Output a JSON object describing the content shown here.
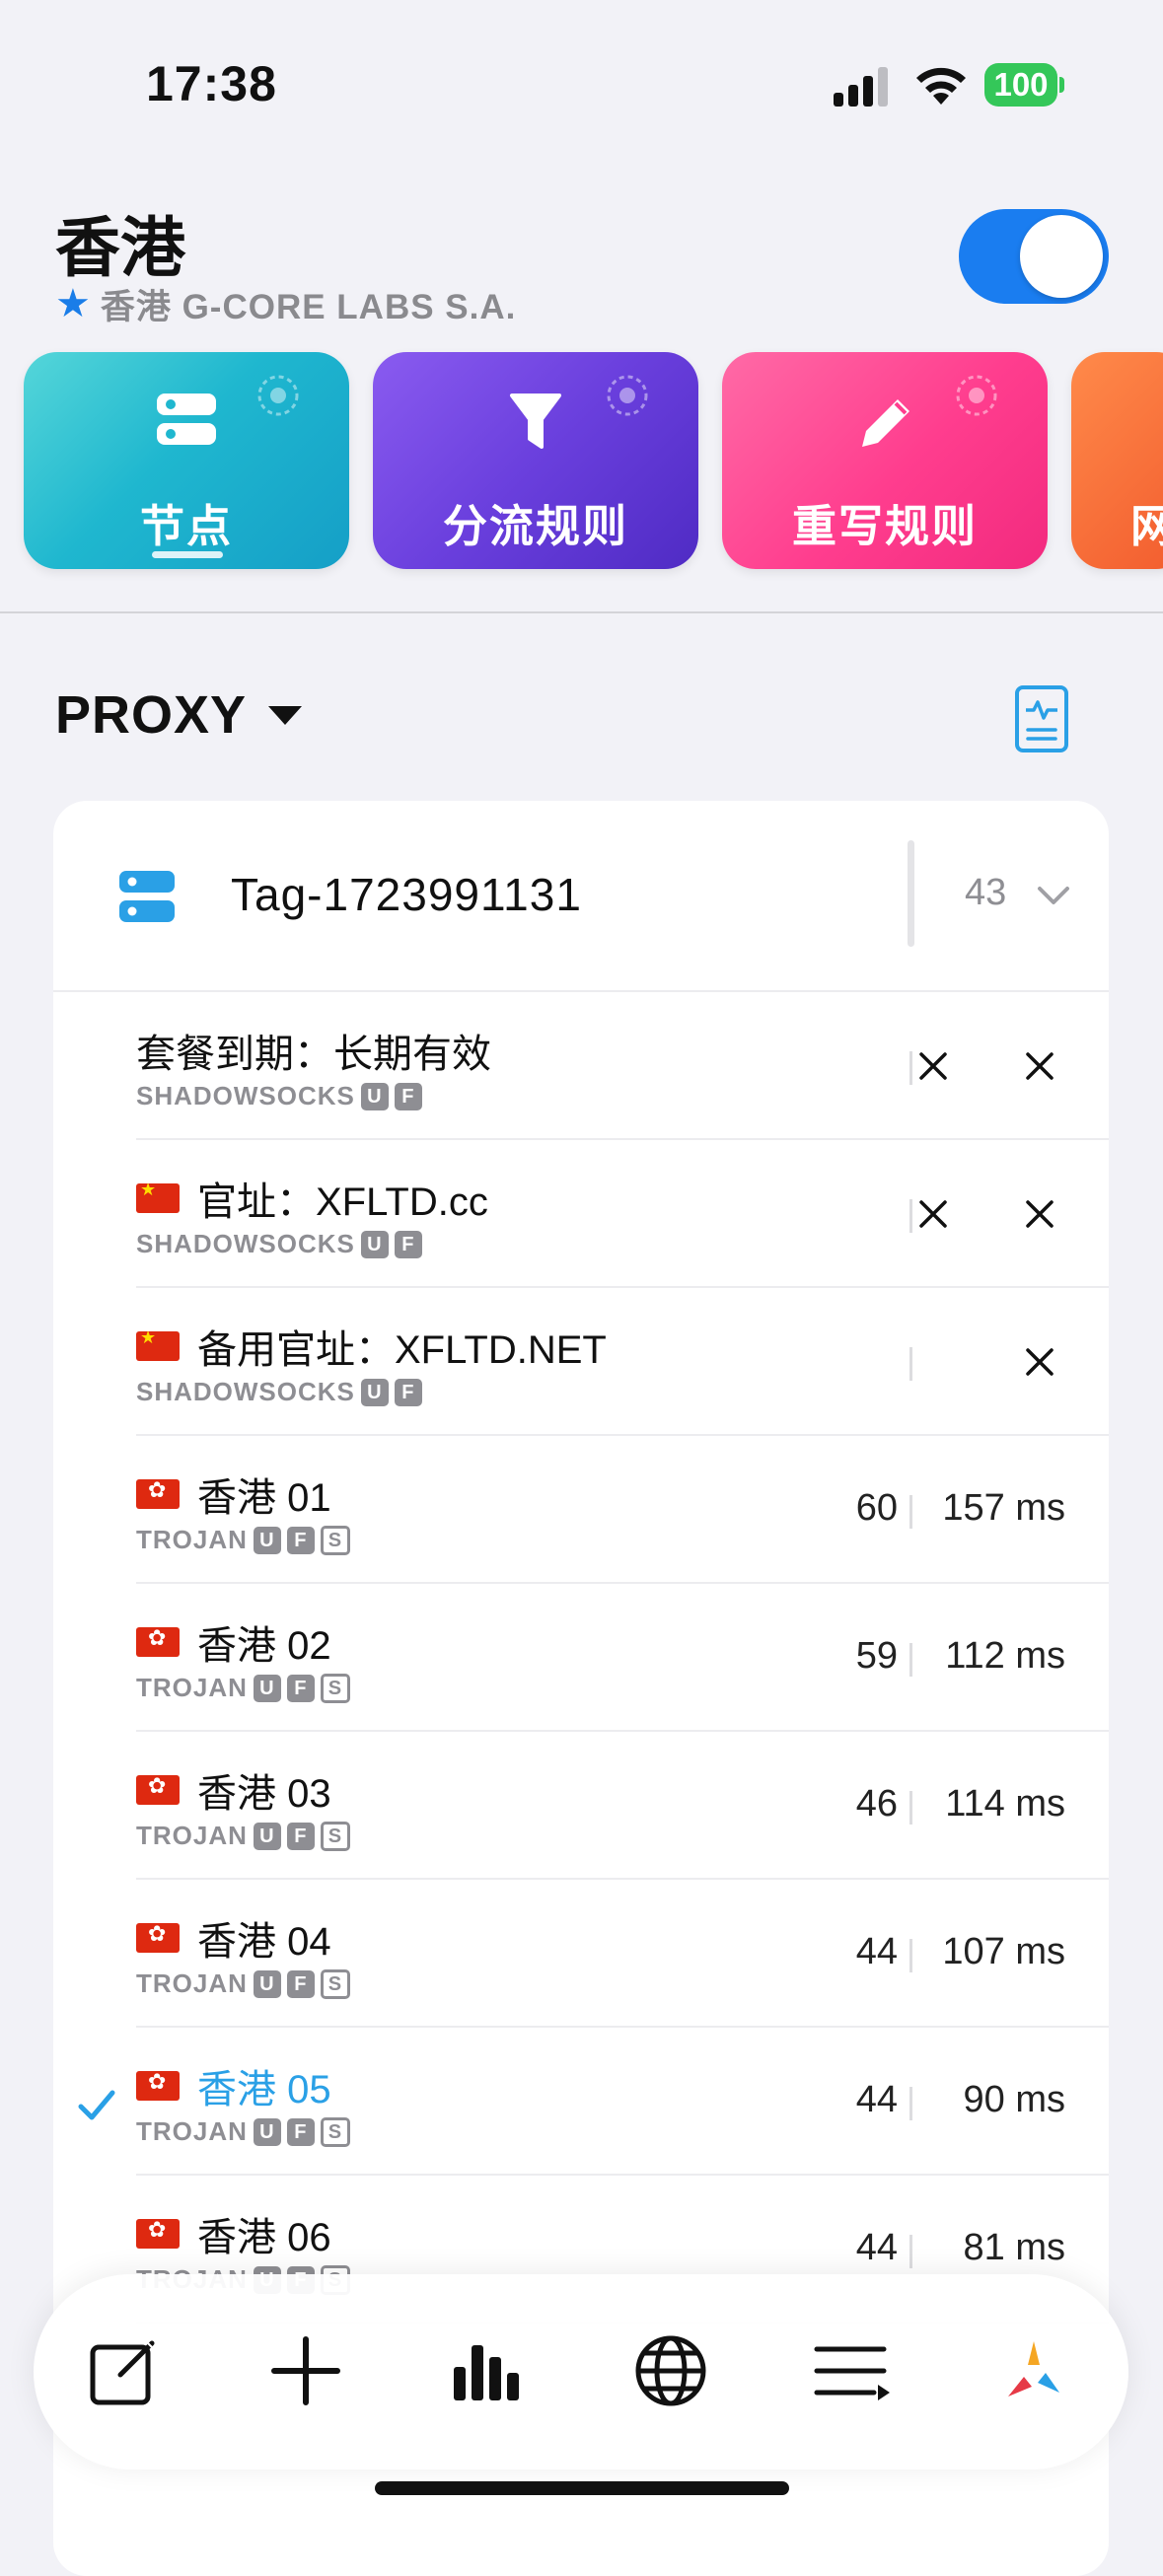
{
  "status": {
    "time": "17:38",
    "battery": "100"
  },
  "header": {
    "title": "香港",
    "subtitle": "香港 G-CORE LABS S.A.",
    "enabled": true
  },
  "cards": [
    {
      "label": "节点",
      "icon": "server-icon",
      "color": "#1fb7cf",
      "active": true
    },
    {
      "label": "分流规则",
      "icon": "filter-icon",
      "color": "#6a3fdd"
    },
    {
      "label": "重写规则",
      "icon": "pencil-icon",
      "color": "#ff3d8e"
    },
    {
      "label": "网",
      "icon": "",
      "color": "#f25c2e"
    }
  ],
  "policy": {
    "name": "PROXY"
  },
  "group": {
    "name": "Tag-1723991131",
    "count": "43"
  },
  "nodes": [
    {
      "name": "套餐到期：长期有效",
      "flag": "",
      "protocol": "SHADOWSOCKS",
      "badges": [
        "U",
        "F"
      ],
      "val1": "",
      "val2": "",
      "x1": true,
      "x2": true
    },
    {
      "name": "官址：XFLTD.cc",
      "flag": "cn",
      "protocol": "SHADOWSOCKS",
      "badges": [
        "U",
        "F"
      ],
      "val1": "",
      "val2": "",
      "x1": true,
      "x2": true
    },
    {
      "name": "备用官址：XFLTD.NET",
      "flag": "cn",
      "protocol": "SHADOWSOCKS",
      "badges": [
        "U",
        "F"
      ],
      "val1": "",
      "val2": "",
      "x1": false,
      "x2": true
    },
    {
      "name": "香港 01",
      "flag": "hk",
      "protocol": "TROJAN",
      "badges": [
        "U",
        "F",
        "S"
      ],
      "val1": "60",
      "val2": "157 ms"
    },
    {
      "name": "香港 02",
      "flag": "hk",
      "protocol": "TROJAN",
      "badges": [
        "U",
        "F",
        "S"
      ],
      "val1": "59",
      "val2": "112 ms"
    },
    {
      "name": "香港 03",
      "flag": "hk",
      "protocol": "TROJAN",
      "badges": [
        "U",
        "F",
        "S"
      ],
      "val1": "46",
      "val2": "114 ms"
    },
    {
      "name": "香港 04",
      "flag": "hk",
      "protocol": "TROJAN",
      "badges": [
        "U",
        "F",
        "S"
      ],
      "val1": "44",
      "val2": "107 ms"
    },
    {
      "name": "香港 05",
      "flag": "hk",
      "protocol": "TROJAN",
      "badges": [
        "U",
        "F",
        "S"
      ],
      "val1": "44",
      "val2": "90 ms",
      "selected": true
    },
    {
      "name": "香港 06",
      "flag": "hk",
      "protocol": "TROJAN",
      "badges": [
        "U",
        "F",
        "S"
      ],
      "val1": "44",
      "val2": "81 ms"
    }
  ],
  "tabbar": [
    "edit-icon",
    "add-icon",
    "stats-icon",
    "globe-icon",
    "list-icon",
    "app-logo-icon"
  ]
}
